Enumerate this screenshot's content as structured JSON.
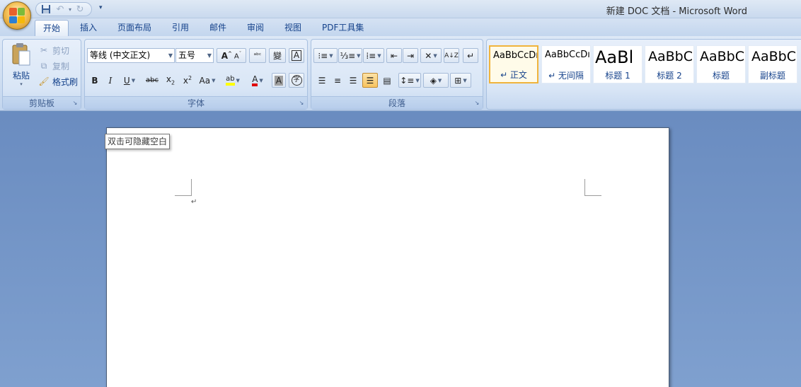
{
  "window": {
    "title": "新建 DOC 文档 - Microsoft Word"
  },
  "quick_access": {
    "icons": [
      "save-icon",
      "undo-icon",
      "redo-icon",
      "customize-icon"
    ]
  },
  "tabs": [
    {
      "label": "开始",
      "active": true
    },
    {
      "label": "插入"
    },
    {
      "label": "页面布局"
    },
    {
      "label": "引用"
    },
    {
      "label": "邮件"
    },
    {
      "label": "审阅"
    },
    {
      "label": "视图"
    },
    {
      "label": "PDF工具集"
    }
  ],
  "clipboard": {
    "paste_label": "粘贴",
    "cut_label": "剪切",
    "copy_label": "复制",
    "format_painter_label": "格式刷",
    "group_label": "剪贴板"
  },
  "font": {
    "font_name": "等线 (中文正文)",
    "font_size": "五号",
    "group_label": "字体",
    "colors": {
      "highlight": "#ffff00",
      "font_color": "#e00000"
    }
  },
  "paragraph": {
    "group_label": "段落"
  },
  "styles": {
    "items": [
      {
        "sample": "AaBbCcDı",
        "name": "↵ 正文",
        "selected": true
      },
      {
        "sample": "AaBbCcDı",
        "name": "↵ 无间隔"
      },
      {
        "sample": "AaBl",
        "name": "标题 1"
      },
      {
        "sample": "AaBbC",
        "name": "标题 2"
      },
      {
        "sample": "AaBbC",
        "name": "标题"
      },
      {
        "sample": "AaBbC",
        "name": "副标题"
      }
    ]
  },
  "document": {
    "tooltip": "双击可隐藏空白",
    "paragraph_mark": "↵"
  }
}
